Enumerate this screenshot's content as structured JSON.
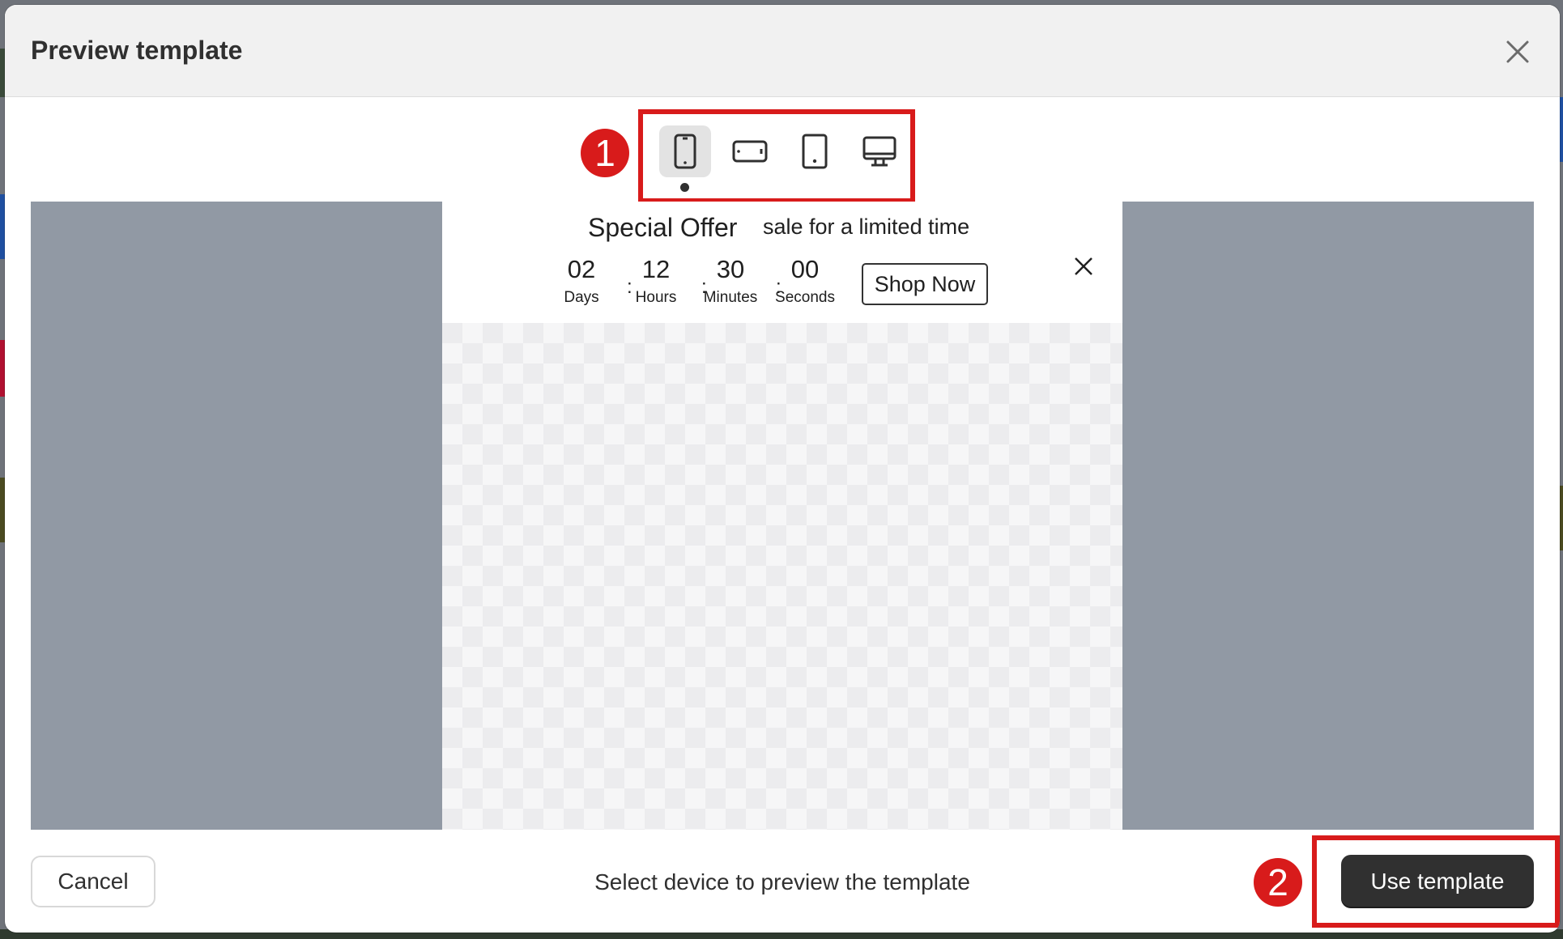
{
  "modal": {
    "title": "Preview template"
  },
  "devices": [
    {
      "name": "mobile",
      "icon": "mobile-portrait-icon",
      "active": true
    },
    {
      "name": "mobile-landscape",
      "icon": "mobile-landscape-icon",
      "active": false
    },
    {
      "name": "tablet",
      "icon": "tablet-icon",
      "active": false
    },
    {
      "name": "desktop",
      "icon": "desktop-icon",
      "active": false
    }
  ],
  "annotations": {
    "step1": "1",
    "step2": "2"
  },
  "banner": {
    "title": "Special Offer",
    "subtitle": "sale for a limited time",
    "countdown": [
      {
        "value": "02",
        "label": "Days"
      },
      {
        "value": "12",
        "label": "Hours"
      },
      {
        "value": "30",
        "label": "Minutes"
      },
      {
        "value": "00",
        "label": "Seconds"
      }
    ],
    "separator": ":",
    "cta": "Shop Now"
  },
  "footer": {
    "cancel": "Cancel",
    "hint": "Select device to preview the template",
    "primary": "Use template"
  },
  "colors": {
    "highlight": "#d81b1b",
    "primary_button": "#303030",
    "preview_background": "#9199a4"
  }
}
